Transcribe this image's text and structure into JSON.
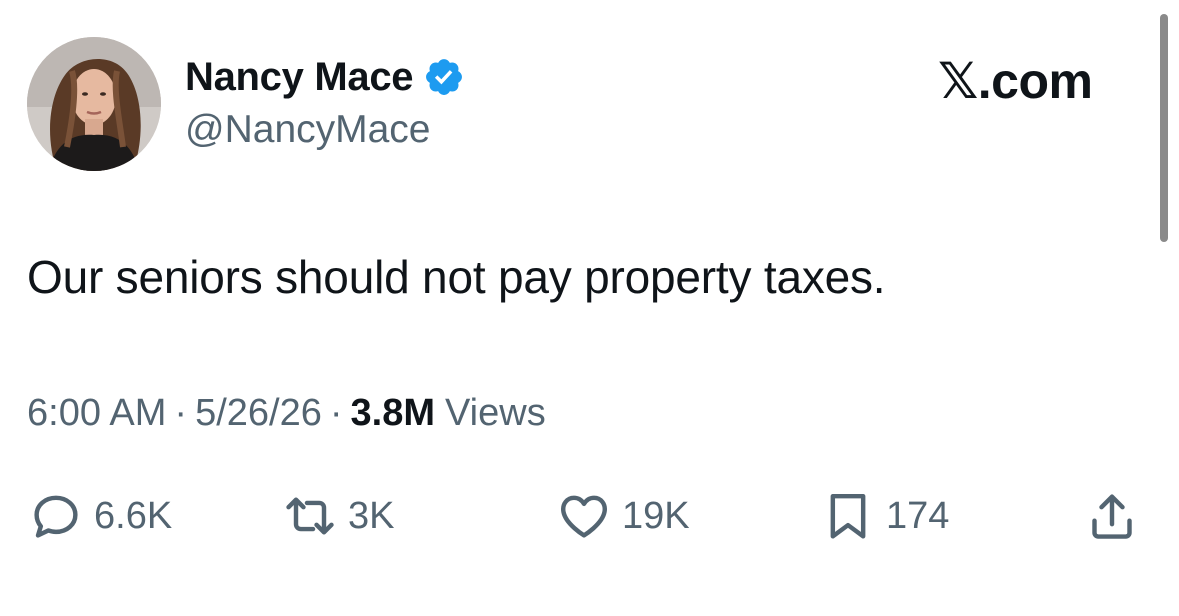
{
  "author": {
    "display_name": "Nancy Mace",
    "handle": "@NancyMace",
    "verified": true,
    "verified_color": "#1d9bf0"
  },
  "brand": {
    "logo_text": "𝕏.com"
  },
  "tweet": {
    "text": "Our seniors should not pay property taxes.",
    "time": "6:00 AM",
    "separator": "·",
    "date": "5/26/26",
    "views_count": "3.8M",
    "views_label": "Views"
  },
  "actions": {
    "reply": {
      "icon": "reply-icon",
      "count": "6.6K"
    },
    "retweet": {
      "icon": "retweet-icon",
      "count": "3K"
    },
    "like": {
      "icon": "heart-icon",
      "count": "19K"
    },
    "bookmark": {
      "icon": "bookmark-icon",
      "count": "174"
    },
    "share": {
      "icon": "share-icon"
    }
  },
  "colors": {
    "text_primary": "#0f1419",
    "text_secondary": "#536471",
    "background": "#ffffff"
  }
}
